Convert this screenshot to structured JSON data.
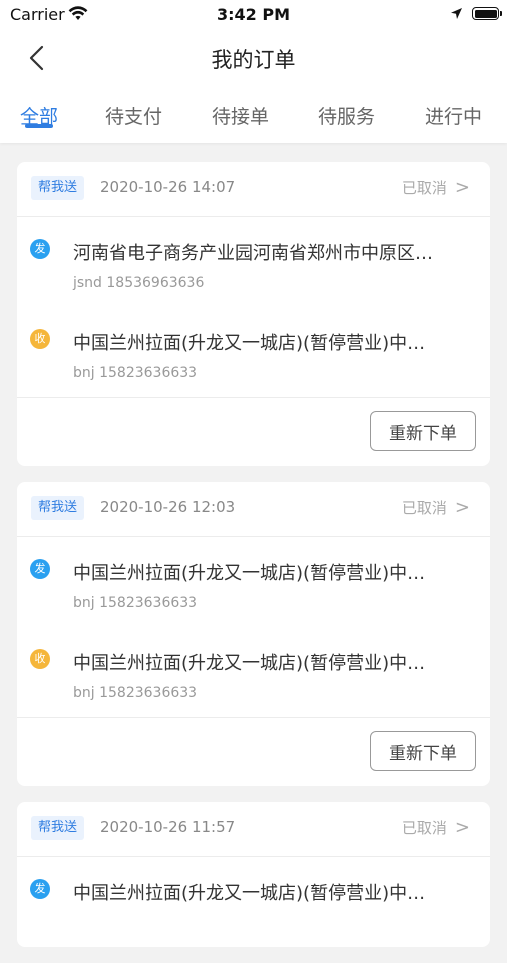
{
  "status_bar": {
    "carrier": "Carrier",
    "time": "3:42 PM"
  },
  "nav": {
    "title": "我的订单"
  },
  "tabs": [
    {
      "label": "全部"
    },
    {
      "label": "待支付"
    },
    {
      "label": "待接单"
    },
    {
      "label": "待服务"
    },
    {
      "label": "进行中"
    }
  ],
  "colors": {
    "accent": "#2f7de1",
    "send_badge": "#2aa0f0",
    "recv_badge": "#f5b63b"
  },
  "orders": [
    {
      "tag": "帮我送",
      "datetime": "2020-10-26 14:07",
      "status": "已取消",
      "chevron": ">",
      "from": {
        "badge": "发",
        "name": "河南省电子商务产业园河南省郑州市中原区…",
        "contact": "jsnd 18536963636"
      },
      "to": {
        "badge": "收",
        "name": "中国兰州拉面(升龙又一城店)(暂停营业)中…",
        "contact": "bnj 15823636633"
      },
      "action": "重新下单"
    },
    {
      "tag": "帮我送",
      "datetime": "2020-10-26 12:03",
      "status": "已取消",
      "chevron": ">",
      "from": {
        "badge": "发",
        "name": "中国兰州拉面(升龙又一城店)(暂停营业)中…",
        "contact": "bnj 15823636633"
      },
      "to": {
        "badge": "收",
        "name": "中国兰州拉面(升龙又一城店)(暂停营业)中…",
        "contact": "bnj 15823636633"
      },
      "action": "重新下单"
    },
    {
      "tag": "帮我送",
      "datetime": "2020-10-26 11:57",
      "status": "已取消",
      "chevron": ">",
      "from": {
        "badge": "发",
        "name": "中国兰州拉面(升龙又一城店)(暂停营业)中…",
        "contact": ""
      },
      "to": null,
      "action": null
    }
  ]
}
